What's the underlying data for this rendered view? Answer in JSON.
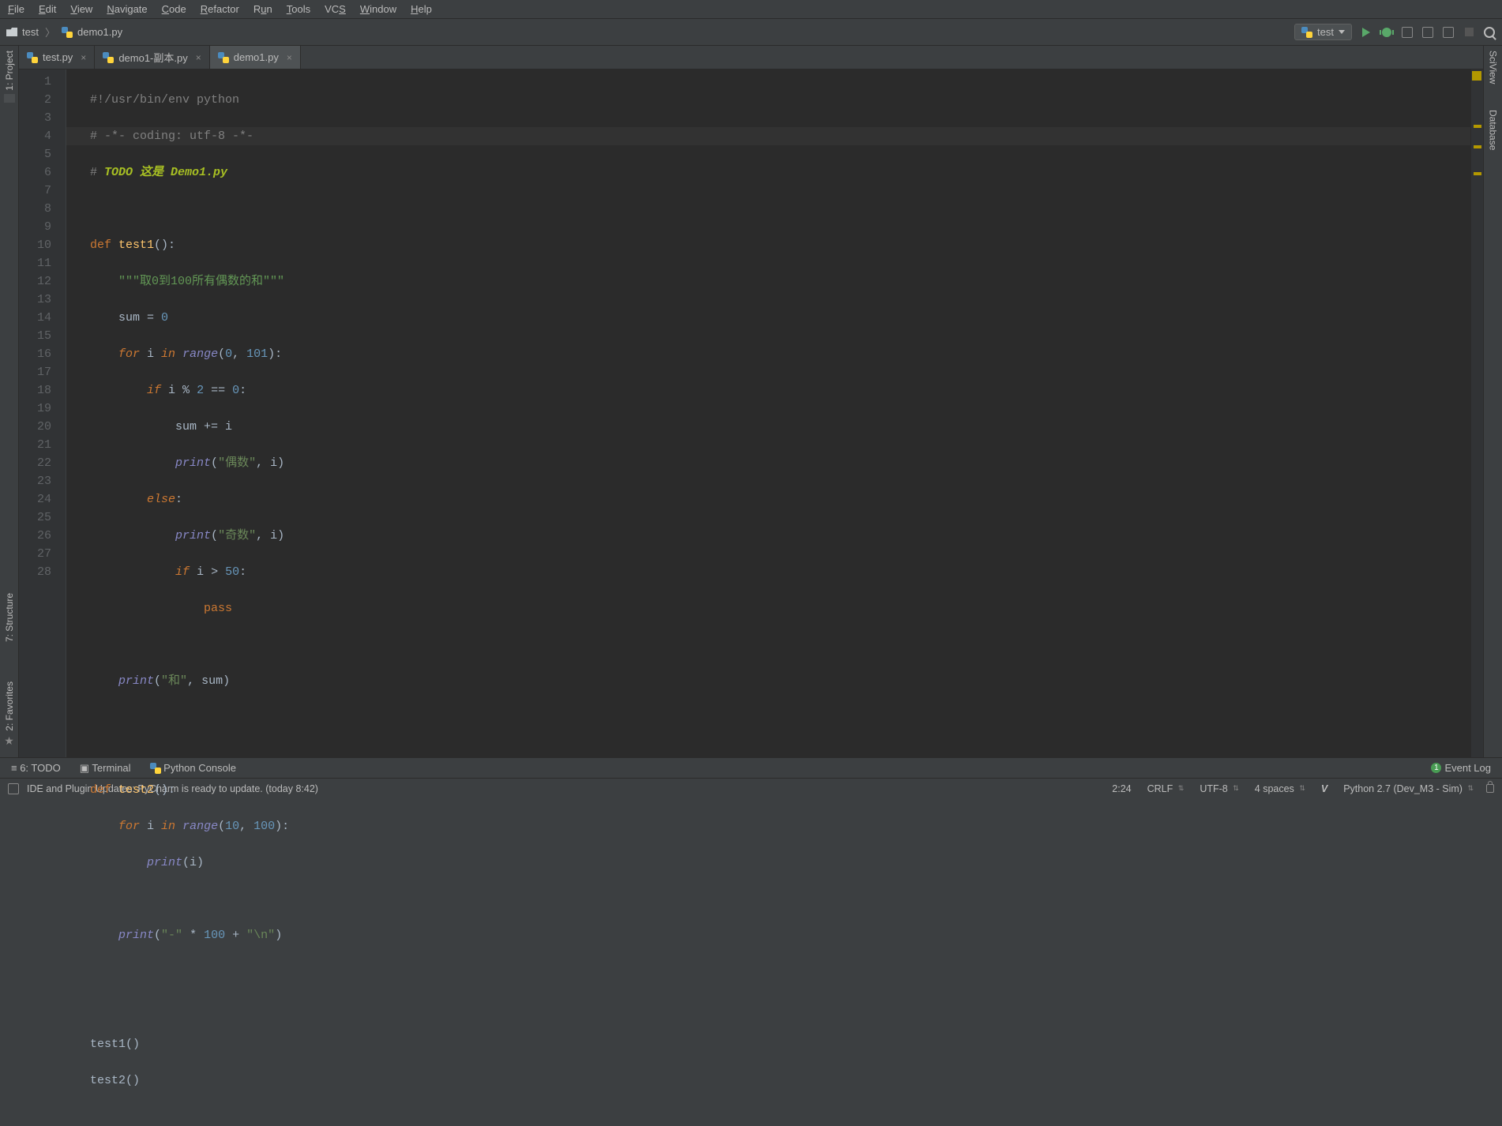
{
  "menu": {
    "file": "File",
    "edit": "Edit",
    "view": "View",
    "navigate": "Navigate",
    "code": "Code",
    "refactor": "Refactor",
    "run": "Run",
    "tools": "Tools",
    "vcs": "VCS",
    "window": "Window",
    "help": "Help"
  },
  "breadcrumb": {
    "folder": "test",
    "file": "demo1.py"
  },
  "run_config": {
    "label": "test"
  },
  "tabs": [
    {
      "label": "test.py",
      "active": false
    },
    {
      "label": "demo1-副本.py",
      "active": false
    },
    {
      "label": "demo1.py",
      "active": true
    }
  ],
  "sidebars": {
    "project": "1: Project",
    "structure": "7: Structure",
    "favorites": "2: Favorites",
    "sciview": "SciView",
    "database": "Database"
  },
  "gutter_lines": [
    "1",
    "2",
    "3",
    "4",
    "5",
    "6",
    "7",
    "8",
    "9",
    "10",
    "11",
    "12",
    "13",
    "14",
    "15",
    "16",
    "17",
    "18",
    "19",
    "20",
    "21",
    "22",
    "23",
    "24",
    "25",
    "26",
    "27",
    "28"
  ],
  "code": {
    "l1_comment": "#!/usr/bin/env python",
    "l2_comment": "# -*- coding: utf-8 -*-",
    "l3_a": "# ",
    "l3_b": "TODO 这是 Demo1.py",
    "l6_doc": "\"\"\"取0到100所有偶数的和\"\"\"",
    "str_even": "\"偶数\"",
    "str_odd": "\"奇数\"",
    "str_sum": "\"和\"",
    "str_dash": "\"-\"",
    "str_nl": "\"\\n\""
  },
  "bottom_tools": {
    "todo": "6: TODO",
    "terminal": "Terminal",
    "console": "Python Console",
    "eventlog": "Event Log",
    "event_count": "1"
  },
  "status": {
    "message": "IDE and Plugin Updates: PyCharm is ready to update. (today 8:42)",
    "cursor": "2:24",
    "line_sep": "CRLF",
    "encoding": "UTF-8",
    "indent": "4 spaces",
    "interpreter": "Python 2.7 (Dev_M3 - Sim)"
  }
}
